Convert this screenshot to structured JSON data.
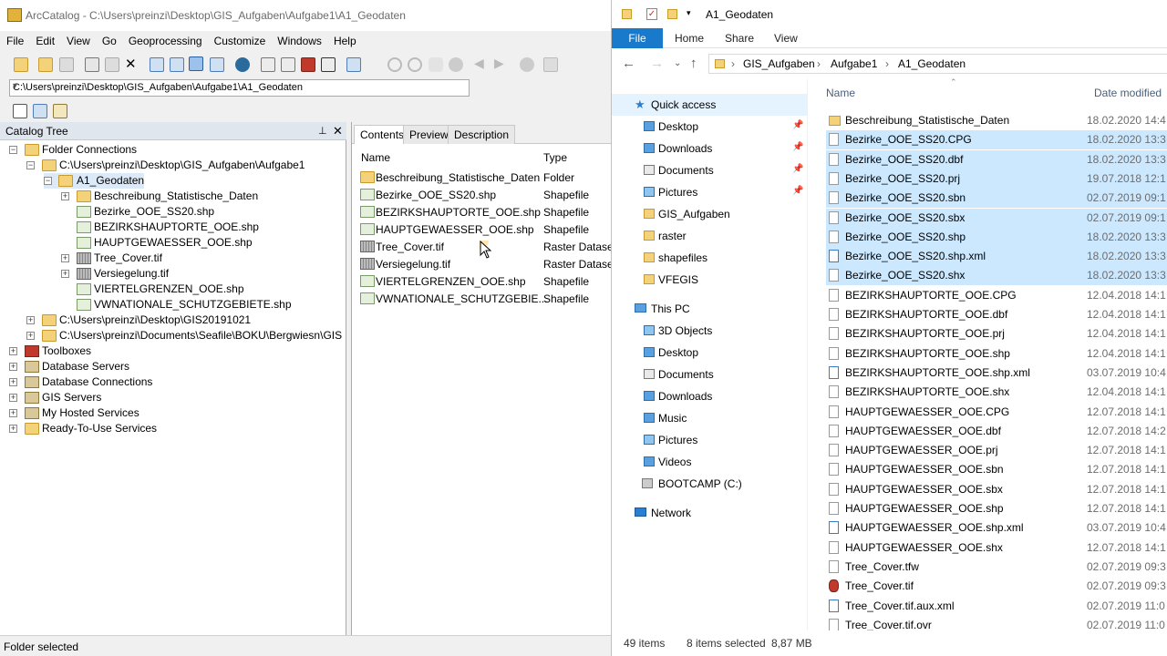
{
  "arc": {
    "title": "ArcCatalog - C:\\Users\\preinzi\\Desktop\\GIS_Aufgaben\\Aufgabe1\\A1_Geodaten",
    "menu": [
      "File",
      "Edit",
      "View",
      "Go",
      "Geoprocessing",
      "Customize",
      "Windows",
      "Help"
    ],
    "address": "C:\\Users\\preinzi\\Desktop\\GIS_Aufgaben\\Aufgabe1\\A1_Geodaten",
    "catalog_title": "Catalog Tree",
    "tree": {
      "folder_connections": "Folder Connections",
      "aufgabe1": "C:\\Users\\preinzi\\Desktop\\GIS_Aufgaben\\Aufgabe1",
      "a1": "A1_Geodaten",
      "children": [
        "Beschreibung_Statistische_Daten",
        "Bezirke_OOE_SS20.shp",
        "BEZIRKSHAUPTORTE_OOE.shp",
        "HAUPTGEWAESSER_OOE.shp",
        "Tree_Cover.tif",
        "Versiegelung.tif",
        "VIERTELGRENZEN_OOE.shp",
        "VWNATIONALE_SCHUTZGEBIETE.shp"
      ],
      "gis2019": "C:\\Users\\preinzi\\Desktop\\GIS20191021",
      "seafile": "C:\\Users\\preinzi\\Documents\\Seafile\\BOKU\\Bergwiesn\\GIS",
      "toolboxes": "Toolboxes",
      "db_servers": "Database Servers",
      "db_connections": "Database Connections",
      "gis_servers": "GIS Servers",
      "hosted": "My Hosted Services",
      "ready": "Ready-To-Use Services"
    },
    "tabs": [
      "Contents",
      "Preview",
      "Description"
    ],
    "columns": {
      "name": "Name",
      "type": "Type"
    },
    "contents": [
      {
        "name": "Beschreibung_Statistische_Daten",
        "type": "Folder"
      },
      {
        "name": "Bezirke_OOE_SS20.shp",
        "type": "Shapefile"
      },
      {
        "name": "BEZIRKSHAUPTORTE_OOE.shp",
        "type": "Shapefile"
      },
      {
        "name": "HAUPTGEWAESSER_OOE.shp",
        "type": "Shapefile"
      },
      {
        "name": "Tree_Cover.tif",
        "type": "Raster Dataset"
      },
      {
        "name": "Versiegelung.tif",
        "type": "Raster Dataset"
      },
      {
        "name": "VIERTELGRENZEN_OOE.shp",
        "type": "Shapefile"
      },
      {
        "name": "VWNATIONALE_SCHUTZGEBIE...",
        "type": "Shapefile"
      }
    ],
    "status": "Folder selected"
  },
  "explorer": {
    "title": "A1_Geodaten",
    "ribbon": {
      "file": "File",
      "home": "Home",
      "share": "Share",
      "view": "View"
    },
    "breadcrumb": [
      "GIS_Aufgaben",
      "Aufgabe1",
      "A1_Geodaten"
    ],
    "nav": {
      "quick_access": "Quick access",
      "quick_items": [
        "Desktop",
        "Downloads",
        "Documents",
        "Pictures",
        "GIS_Aufgaben",
        "raster",
        "shapefiles",
        "VFEGIS"
      ],
      "this_pc": "This PC",
      "pc_items": [
        "3D Objects",
        "Desktop",
        "Documents",
        "Downloads",
        "Music",
        "Pictures",
        "Videos",
        "BOOTCAMP (C:)"
      ],
      "network": "Network"
    },
    "columns": {
      "name": "Name",
      "date": "Date modified"
    },
    "files": [
      {
        "name": "Beschreibung_Statistische_Daten",
        "date": "18.02.2020 14:4",
        "kind": "folder",
        "selected": false
      },
      {
        "name": "Bezirke_OOE_SS20.CPG",
        "date": "18.02.2020 13:3",
        "kind": "file",
        "selected": true
      },
      {
        "name": "Bezirke_OOE_SS20.dbf",
        "date": "18.02.2020 13:3",
        "kind": "file",
        "selected": true
      },
      {
        "name": "Bezirke_OOE_SS20.prj",
        "date": "19.07.2018 12:1",
        "kind": "file",
        "selected": true
      },
      {
        "name": "Bezirke_OOE_SS20.sbn",
        "date": "02.07.2019 09:1",
        "kind": "file",
        "selected": true
      },
      {
        "name": "Bezirke_OOE_SS20.sbx",
        "date": "02.07.2019 09:1",
        "kind": "file",
        "selected": true
      },
      {
        "name": "Bezirke_OOE_SS20.shp",
        "date": "18.02.2020 13:3",
        "kind": "file",
        "selected": true
      },
      {
        "name": "Bezirke_OOE_SS20.shp.xml",
        "date": "18.02.2020 13:3",
        "kind": "xml",
        "selected": true
      },
      {
        "name": "Bezirke_OOE_SS20.shx",
        "date": "18.02.2020 13:3",
        "kind": "file",
        "selected": true
      },
      {
        "name": "BEZIRKSHAUPTORTE_OOE.CPG",
        "date": "12.04.2018 14:1",
        "kind": "file",
        "selected": false
      },
      {
        "name": "BEZIRKSHAUPTORTE_OOE.dbf",
        "date": "12.04.2018 14:1",
        "kind": "file",
        "selected": false
      },
      {
        "name": "BEZIRKSHAUPTORTE_OOE.prj",
        "date": "12.04.2018 14:1",
        "kind": "file",
        "selected": false
      },
      {
        "name": "BEZIRKSHAUPTORTE_OOE.shp",
        "date": "12.04.2018 14:1",
        "kind": "file",
        "selected": false
      },
      {
        "name": "BEZIRKSHAUPTORTE_OOE.shp.xml",
        "date": "03.07.2019 10:4",
        "kind": "xml",
        "selected": false
      },
      {
        "name": "BEZIRKSHAUPTORTE_OOE.shx",
        "date": "12.04.2018 14:1",
        "kind": "file",
        "selected": false
      },
      {
        "name": "HAUPTGEWAESSER_OOE.CPG",
        "date": "12.07.2018 14:1",
        "kind": "file",
        "selected": false
      },
      {
        "name": "HAUPTGEWAESSER_OOE.dbf",
        "date": "12.07.2018 14:2",
        "kind": "file",
        "selected": false
      },
      {
        "name": "HAUPTGEWAESSER_OOE.prj",
        "date": "12.07.2018 14:1",
        "kind": "file",
        "selected": false
      },
      {
        "name": "HAUPTGEWAESSER_OOE.sbn",
        "date": "12.07.2018 14:1",
        "kind": "file",
        "selected": false
      },
      {
        "name": "HAUPTGEWAESSER_OOE.sbx",
        "date": "12.07.2018 14:1",
        "kind": "file",
        "selected": false
      },
      {
        "name": "HAUPTGEWAESSER_OOE.shp",
        "date": "12.07.2018 14:1",
        "kind": "file",
        "selected": false
      },
      {
        "name": "HAUPTGEWAESSER_OOE.shp.xml",
        "date": "03.07.2019 10:4",
        "kind": "xml",
        "selected": false
      },
      {
        "name": "HAUPTGEWAESSER_OOE.shx",
        "date": "12.07.2018 14:1",
        "kind": "file",
        "selected": false
      },
      {
        "name": "Tree_Cover.tfw",
        "date": "02.07.2019 09:3",
        "kind": "file",
        "selected": false
      },
      {
        "name": "Tree_Cover.tif",
        "date": "02.07.2019 09:3",
        "kind": "tif",
        "selected": false
      },
      {
        "name": "Tree_Cover.tif.aux.xml",
        "date": "02.07.2019 11:0",
        "kind": "xml",
        "selected": false
      },
      {
        "name": "Tree_Cover.tif.ovr",
        "date": "02.07.2019 11:0",
        "kind": "file",
        "selected": false
      }
    ],
    "status": {
      "items": "49 items",
      "selected": "8 items selected",
      "size": "8,87 MB"
    }
  }
}
